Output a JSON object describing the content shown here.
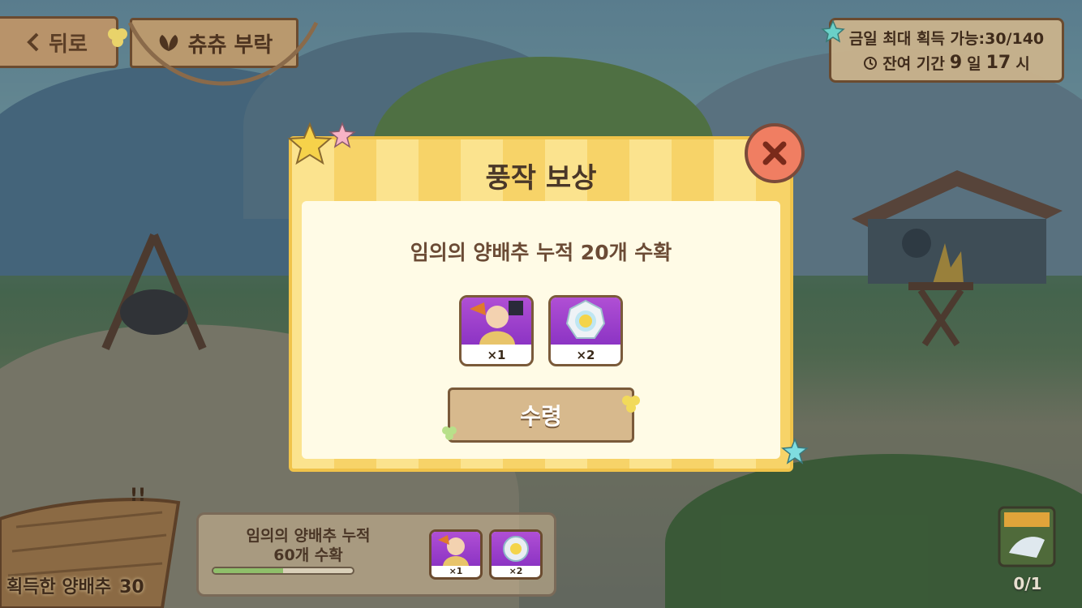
{
  "header": {
    "back_label": "뒤로",
    "title": "츄츄 부락"
  },
  "info": {
    "daily_limit": "금일 최대 획득 가능:30/140",
    "remaining_prefix": "잔여 기간",
    "remaining_days": "9",
    "days_unit": "일",
    "remaining_hours": "17",
    "hours_unit": "시"
  },
  "modal": {
    "title": "풍작 보상",
    "mission": "임의의 양배추 누적 20개 수확",
    "rewards": [
      {
        "icon": "character-card-icon",
        "qty": "×1"
      },
      {
        "icon": "gear-core-icon",
        "qty": "×2"
      }
    ],
    "claim_label": "수령",
    "close_icon": "close-icon"
  },
  "mission_panel": {
    "line1": "임의의 양배추 누적",
    "line2": "60개 수확",
    "progress": 0.5,
    "rewards": [
      {
        "icon": "character-card-icon",
        "qty": "×1"
      },
      {
        "icon": "gear-core-icon",
        "qty": "×2"
      }
    ]
  },
  "cabbage": {
    "label": "획득한 양배추",
    "count": "30"
  },
  "seeds": {
    "count": "0/1"
  },
  "colors": {
    "modal_border": "#f0c34a",
    "close_button": "#f07e62",
    "wood": "#b8936a",
    "reward_purple": "#b04fd4",
    "progress_fill": "#8fbf6a"
  }
}
